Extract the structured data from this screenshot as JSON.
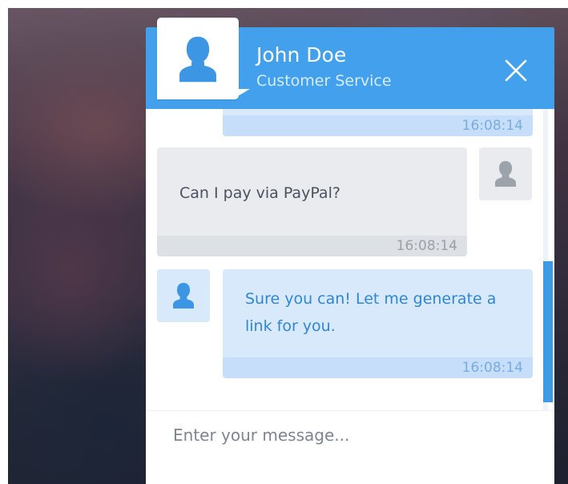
{
  "colors": {
    "header_blue": "#42a0ec",
    "incoming_bubble": "#e9ebee",
    "outgoing_bubble": "#d8e9fb",
    "outgoing_text": "#2f86d6"
  },
  "header": {
    "avatar_icon": "user-silhouette-icon",
    "name": "John Doe",
    "role": "Customer Service",
    "close_icon": "close-x-icon"
  },
  "messages": [
    {
      "direction": "outgoing",
      "text": "",
      "time": "16:08:14"
    },
    {
      "direction": "incoming",
      "text": "Can I pay via PayPal?",
      "time": "16:08:14",
      "avatar_icon": "user-silhouette-icon"
    },
    {
      "direction": "outgoing",
      "text": "Sure you can! Let me generate a link for you.",
      "time": "16:08:14",
      "avatar_icon": "user-silhouette-icon"
    }
  ],
  "composer": {
    "placeholder": "Enter your message...",
    "value": ""
  }
}
